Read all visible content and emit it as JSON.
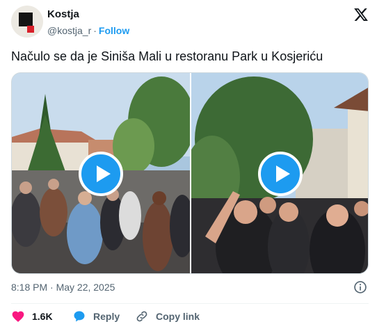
{
  "author": {
    "name": "Kostja",
    "handle": "@kostja_r",
    "separator": "·",
    "follow_label": "Follow"
  },
  "tweet": {
    "text": "Načulo se da je Siniša Mali u restoranu Park u Kosjeriću",
    "timestamp": "8:18 PM · May 22, 2025"
  },
  "media": {
    "videos": [
      {
        "icon": "play-icon"
      },
      {
        "icon": "play-icon"
      }
    ]
  },
  "actions": {
    "like_count": "1.6K",
    "reply_label": "Reply",
    "copy_link_label": "Copy link"
  },
  "colors": {
    "accent": "#1d9bf0",
    "like": "#f91880",
    "text": "#0f1419",
    "secondary": "#536471"
  }
}
